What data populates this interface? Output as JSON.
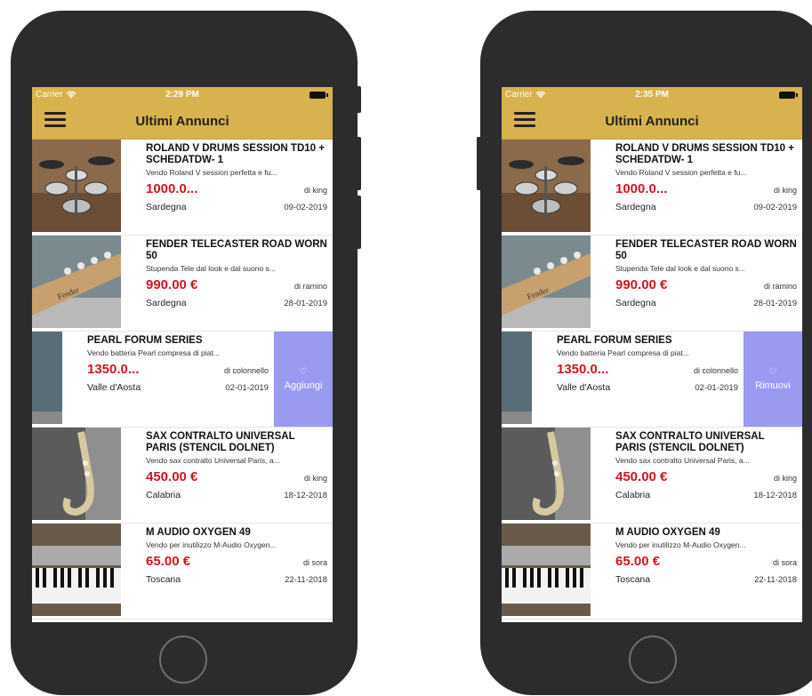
{
  "phones": [
    {
      "status": {
        "carrier": "Carrier",
        "time": "2:29 PM"
      },
      "nav": {
        "title": "Ultimi Annunci"
      },
      "items": [
        {
          "title": "ROLAND V DRUMS SESSION TD10 + SCHEDATDW- 1",
          "desc": "Vendo Roland V session perfetta e fu...",
          "price": "1000.0...",
          "seller": "di king",
          "location": "Sardegna",
          "date": "09-02-2019",
          "thumb": "drums"
        },
        {
          "title": "FENDER TELECASTER ROAD WORN 50",
          "desc": "Stupenda Tele dal look e dal suono s...",
          "price": "990.00 €",
          "seller": "di ramino",
          "location": "Sardegna",
          "date": "28-01-2019",
          "thumb": "guitar"
        },
        {
          "title": "PEARL FORUM SERIES",
          "desc": "Vendo batteria Pearl compresa di piat...",
          "price": "1350.0...",
          "seller": "di colonnello",
          "location": "Valle d'Aosta",
          "date": "02-01-2019",
          "thumb": "pearl",
          "swiped": true,
          "action": "Aggiungi"
        },
        {
          "title": "SAX CONTRALTO UNIVERSAL PARIS (STENCIL DOLNET)",
          "desc": "Vendo sax contralto Universal Paris, a...",
          "price": "450.00 €",
          "seller": "di king",
          "location": "Calabria",
          "date": "18-12-2018",
          "thumb": "sax"
        },
        {
          "title": "M AUDIO OXYGEN 49",
          "desc": "Vendo per inutilizzo M-Audio Oxygen...",
          "price": "65.00 €",
          "seller": "di sora",
          "location": "Toscana",
          "date": "22-11-2018",
          "thumb": "keys"
        }
      ]
    },
    {
      "status": {
        "carrier": "Carrier",
        "time": "2:35 PM"
      },
      "nav": {
        "title": "Ultimi Annunci"
      },
      "items": [
        {
          "title": "ROLAND V DRUMS SESSION TD10 + SCHEDATDW- 1",
          "desc": "Vendo Roland V session perfetta e fu...",
          "price": "1000.0...",
          "seller": "di king",
          "location": "Sardegna",
          "date": "09-02-2019",
          "thumb": "drums"
        },
        {
          "title": "FENDER TELECASTER ROAD WORN 50",
          "desc": "Stupenda Tele dal look e dal suono s...",
          "price": "990.00 €",
          "seller": "di ramino",
          "location": "Sardegna",
          "date": "28-01-2019",
          "thumb": "guitar"
        },
        {
          "title": "PEARL FORUM SERIES",
          "desc": "Vendo batteria Pearl compresa di piat...",
          "price": "1350.0...",
          "seller": "di colonnello",
          "location": "Valle d'Aosta",
          "date": "02-01-2019",
          "thumb": "pearl",
          "swiped": true,
          "action": "Rimuovi"
        },
        {
          "title": "SAX CONTRALTO UNIVERSAL PARIS (STENCIL DOLNET)",
          "desc": "Vendo sax contralto Universal Paris, a...",
          "price": "450.00 €",
          "seller": "di king",
          "location": "Calabria",
          "date": "18-12-2018",
          "thumb": "sax"
        },
        {
          "title": "M AUDIO OXYGEN 49",
          "desc": "Vendo per inutilizzo M-Audio Oxygen...",
          "price": "65.00 €",
          "seller": "di sora",
          "location": "Toscana",
          "date": "22-11-2018",
          "thumb": "keys"
        }
      ]
    }
  ],
  "colors": {
    "accent": "#d8b24e",
    "price": "#d0161f",
    "swipe_action": "#9a9af0"
  }
}
